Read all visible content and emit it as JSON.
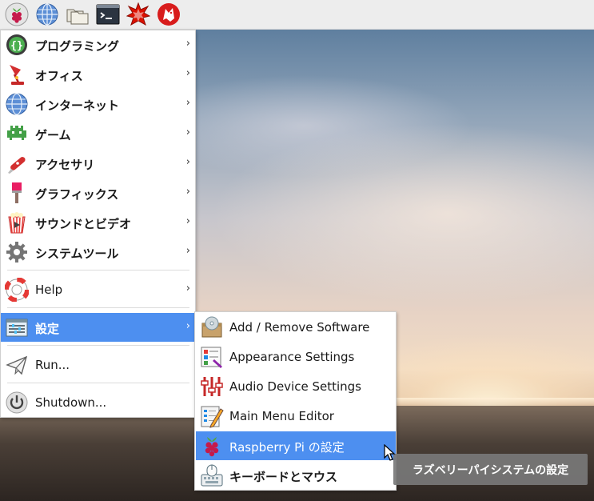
{
  "panel": {
    "buttons": [
      {
        "name": "raspberry-menu-button",
        "icon": "raspberry-icon"
      },
      {
        "name": "web-browser-button",
        "icon": "globe-icon"
      },
      {
        "name": "file-manager-button",
        "icon": "folders-icon"
      },
      {
        "name": "terminal-button",
        "icon": "terminal-icon"
      },
      {
        "name": "mathematica-button",
        "icon": "mathematica-icon"
      },
      {
        "name": "wolfram-button",
        "icon": "wolfram-icon"
      }
    ]
  },
  "menu": {
    "items": [
      {
        "label": "プログラミング",
        "icon": "programming-icon",
        "has_submenu": true
      },
      {
        "label": "オフィス",
        "icon": "office-lamp-icon",
        "has_submenu": true
      },
      {
        "label": "インターネット",
        "icon": "globe-icon",
        "has_submenu": true
      },
      {
        "label": "ゲーム",
        "icon": "games-invader-icon",
        "has_submenu": true
      },
      {
        "label": "アクセサリ",
        "icon": "accessories-knife-icon",
        "has_submenu": true
      },
      {
        "label": "グラフィックス",
        "icon": "graphics-brush-icon",
        "has_submenu": true
      },
      {
        "label": "サウンドとビデオ",
        "icon": "sound-video-icon",
        "has_submenu": true
      },
      {
        "label": "システムツール",
        "icon": "system-gear-icon",
        "has_submenu": true
      },
      {
        "label": "Help",
        "icon": "help-lifebuoy-icon",
        "has_submenu": true
      },
      {
        "label": "設定",
        "icon": "preferences-icon",
        "has_submenu": true,
        "active": true
      },
      {
        "label": "Run...",
        "icon": "run-paper-plane-icon",
        "has_submenu": false
      },
      {
        "label": "Shutdown...",
        "icon": "shutdown-icon",
        "has_submenu": false
      }
    ],
    "arrow": "›"
  },
  "submenu": {
    "items": [
      {
        "label": "Add / Remove Software",
        "icon": "add-remove-software-icon"
      },
      {
        "label": "Appearance Settings",
        "icon": "appearance-icon"
      },
      {
        "label": "Audio Device Settings",
        "icon": "audio-sliders-icon"
      },
      {
        "label": "Main Menu Editor",
        "icon": "menu-editor-icon"
      },
      {
        "label": "Raspberry Pi の設定",
        "icon": "raspberry-icon",
        "active": true
      },
      {
        "label": "キーボードとマウス",
        "icon": "keyboard-mouse-icon"
      }
    ]
  },
  "tooltip": {
    "text": "ラズベリーパイシステムの設定"
  },
  "colors": {
    "highlight": "#4d8ff0",
    "panel_bg": "#ededed",
    "tooltip_bg": "#787878"
  }
}
